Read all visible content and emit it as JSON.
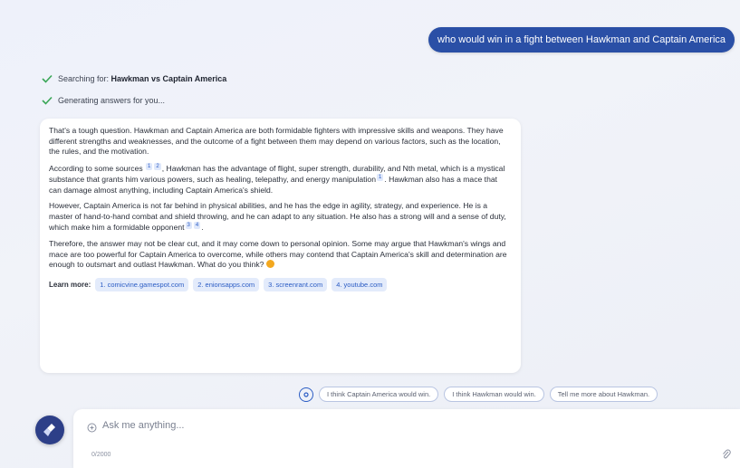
{
  "conversation": {
    "user_message": "who would win in a fight between Hawkman and Captain America",
    "status": [
      {
        "prefix": "Searching for: ",
        "bold": "Hawkman vs Captain America"
      },
      {
        "prefix": "Generating answers for you...",
        "bold": ""
      }
    ],
    "answer": {
      "paragraphs": [
        "That's a tough question. Hawkman and Captain America are both formidable fighters with impressive skills and weapons. They have different strengths and weaknesses, and the outcome of a fight between them may depend on various factors, such as the location, the rules, and the motivation.",
        "According to some sources",
        ", Hawkman has the advantage of flight, super strength, durability, and Nth metal, which is a mystical substance that grants him various powers, such as healing, telepathy, and energy manipulation",
        ". Hawkman also has a mace that can damage almost anything, including Captain America's shield.",
        "However, Captain America is not far behind in physical abilities, and he has the edge in agility, strategy, and experience. He is a master of hand-to-hand combat and shield throwing, and he can adapt to any situation. He also has a strong will and a sense of duty, which make him a formidable opponent",
        "Therefore, the answer may not be clear cut, and it may come down to personal opinion. Some may argue that Hawkman's wings and mace are too powerful for Captain America to overcome, while others may contend that Captain America's skill and determination are enough to outsmart and outlast Hawkman. What do you think?"
      ],
      "citations": [
        "1",
        "2",
        "1",
        "3",
        "4"
      ],
      "learn_more": {
        "label": "Learn more:",
        "sources": [
          "1. comicvine.gamespot.com",
          "2. enionsapps.com",
          "3. screenrant.com",
          "4. youtube.com"
        ]
      }
    }
  },
  "suggestions": [
    "I think Captain America would win.",
    "I think Hawkman would win.",
    "Tell me more about Hawkman."
  ],
  "composer": {
    "placeholder": "Ask me anything...",
    "char_count": "0/2000"
  },
  "colors": {
    "user_bubble": "#2a4fa6",
    "accent": "#2b5cc4",
    "new_topic_button": "#2d3f88",
    "check": "#3aa757"
  }
}
